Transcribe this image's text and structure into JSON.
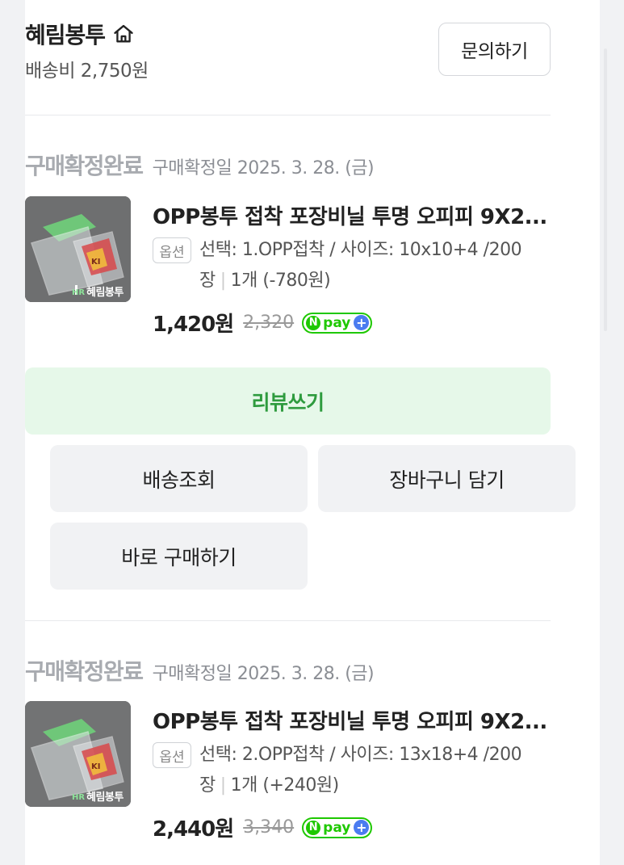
{
  "seller": {
    "name": "혜림봉투",
    "shipping": "배송비 2,750원",
    "ask_label": "문의하기"
  },
  "orders": [
    {
      "status": "구매확정완료",
      "date": "구매확정일 2025. 3. 28. (금)",
      "title": "OPP봉투 접착 포장비닐 투명 오피피 9X2...",
      "option_badge": "옵션",
      "option_main": "선택: 1.OPP접착 / 사이즈: 10x10+4 /200장",
      "option_qty": "1개 (-780원)",
      "price": "1,420원",
      "original_price": "2,320",
      "thumb_brand": "혜림봉투"
    },
    {
      "status": "구매확정완료",
      "date": "구매확정일 2025. 3. 28. (금)",
      "title": "OPP봉투 접착 포장비닐 투명 오피피 9X2...",
      "option_badge": "옵션",
      "option_main": "선택: 2.OPP접착 / 사이즈: 13x18+4 /200장",
      "option_qty": "1개 (+240원)",
      "price": "2,440원",
      "original_price": "3,340",
      "thumb_brand": "혜림봉투"
    }
  ],
  "npay": {
    "n": "N",
    "text": "pay",
    "plus": "+"
  },
  "buttons": {
    "review": "리뷰쓰기",
    "track": "배송조회",
    "cart": "장바구니 담기",
    "buy_now": "바로 구매하기"
  },
  "colors": {
    "review_bg": "#e6f8e9",
    "review_text": "#2e9b3e",
    "npay_green": "#1ec800",
    "npay_blue": "#4b7cf0"
  }
}
